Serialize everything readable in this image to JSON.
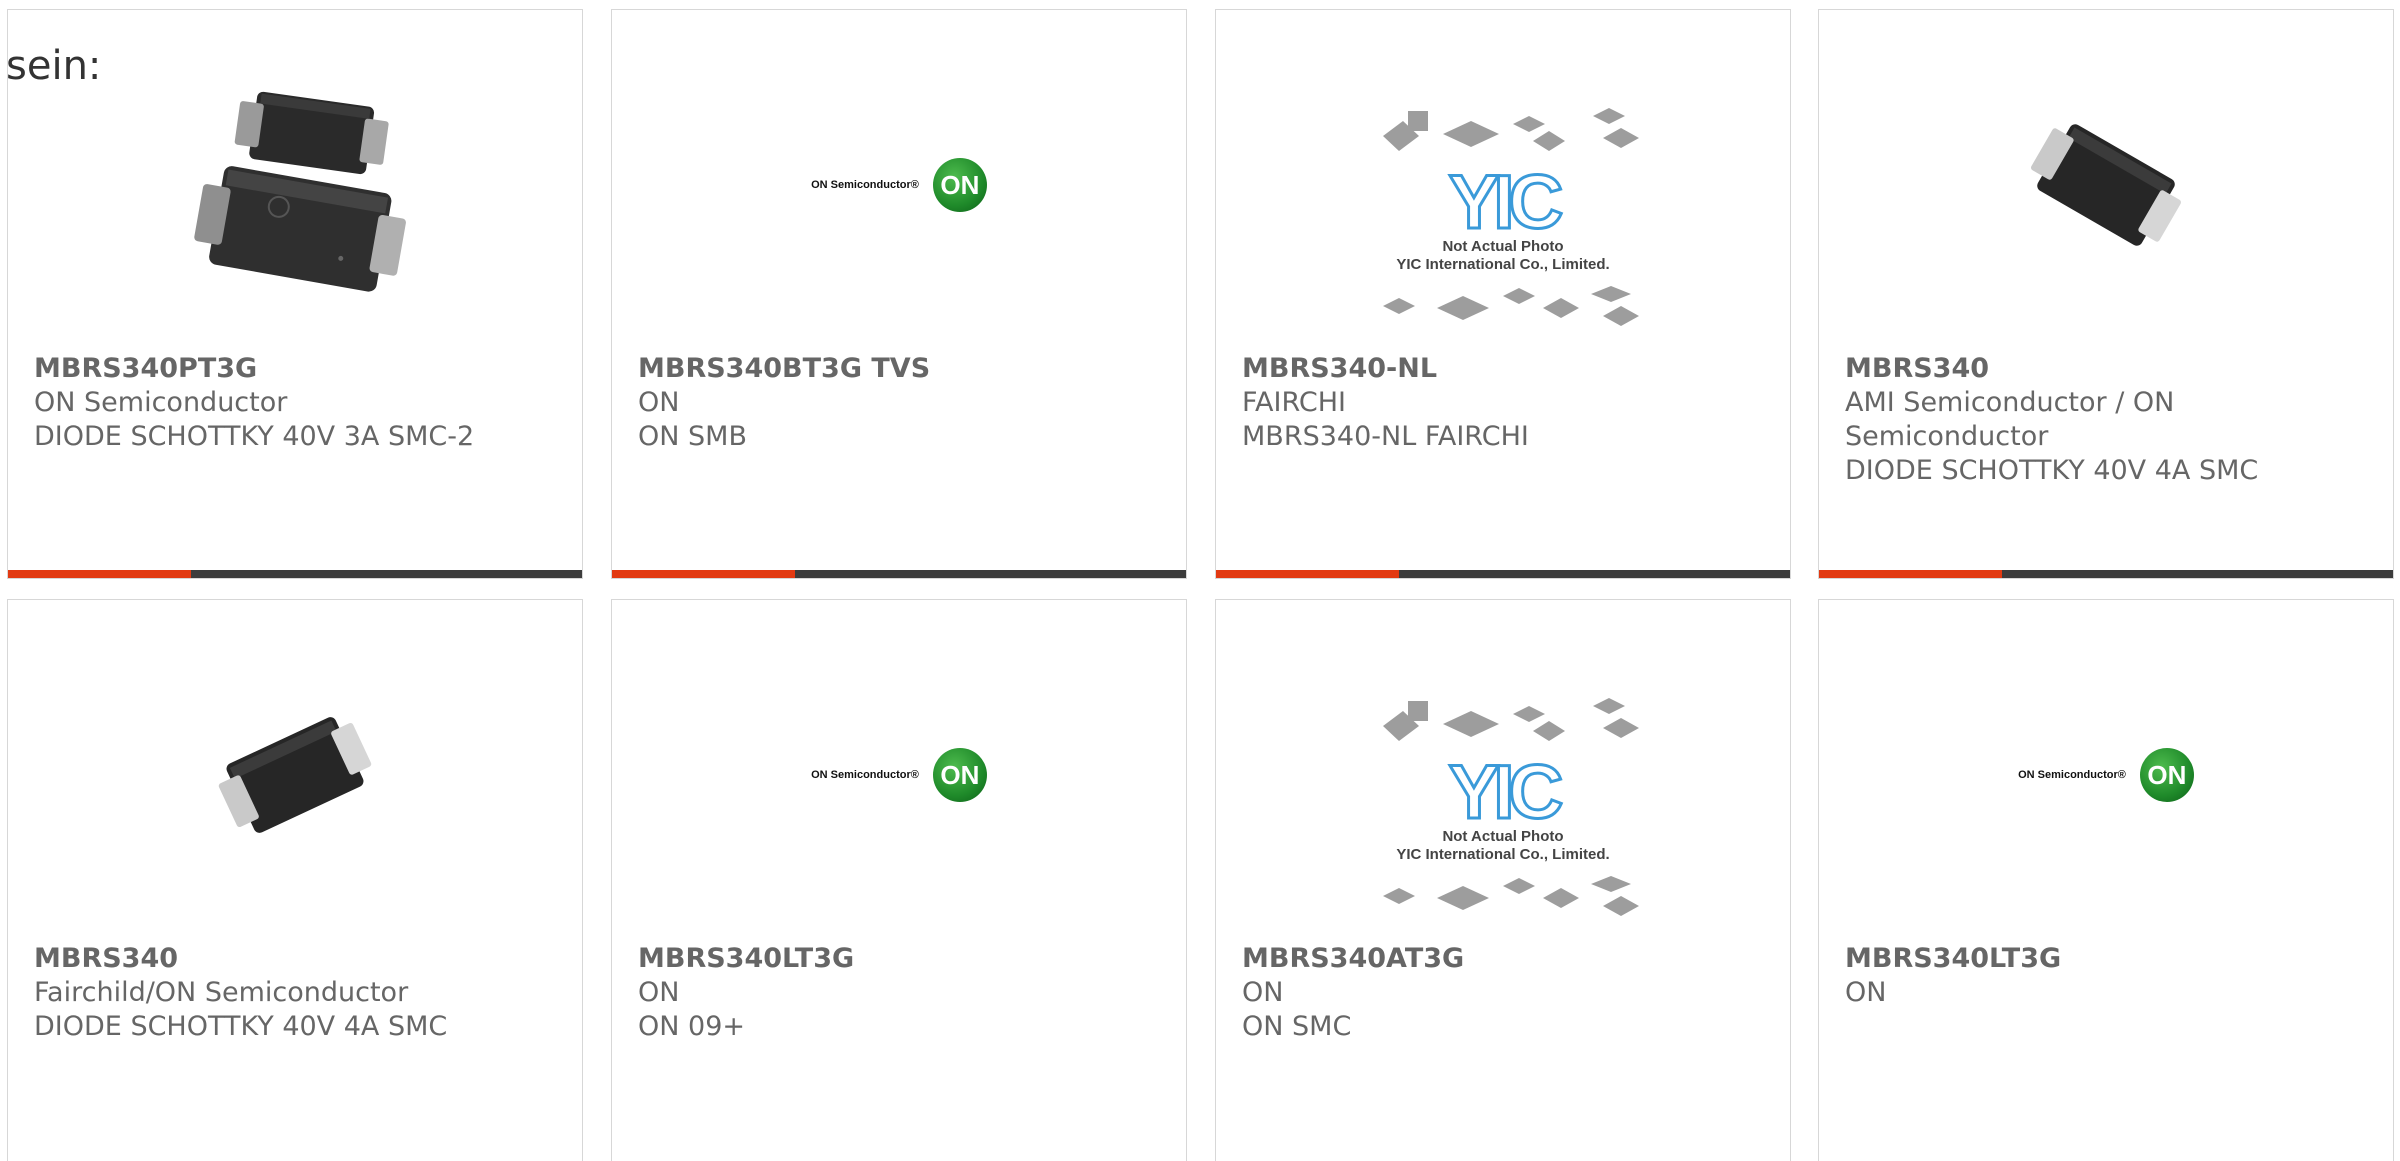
{
  "intro_text": "sein:",
  "colors": {
    "accent": "#e23a12",
    "bar_dark": "#3c3c3c",
    "border": "#d7d7d7",
    "text": "#666666"
  },
  "yic_placeholder": {
    "mark": "YIC",
    "line1": "Not Actual Photo",
    "line2": "YIC International Co., Limited."
  },
  "on_logo": {
    "text": "ON Semiconductor®",
    "circle": "ON"
  },
  "products": [
    {
      "part": "MBRS340PT3G",
      "maker": "ON Semiconductor",
      "desc": "DIODE SCHOTTKY 40V 3A SMC-2",
      "image": "smc-two-package-photo"
    },
    {
      "part": "MBRS340BT3G TVS",
      "maker": "ON",
      "desc": "ON SMB",
      "image": "on-semiconductor-logo"
    },
    {
      "part": "MBRS340-NL",
      "maker": "FAIRCHI",
      "desc": "MBRS340-NL FAIRCHI",
      "image": "yic-not-actual-photo"
    },
    {
      "part": "MBRS340",
      "maker": "AMI Semiconductor / ON Semiconductor",
      "desc": "DIODE SCHOTTKY 40V 4A SMC",
      "image": "smc-package-photo"
    },
    {
      "part": "MBRS340",
      "maker": "Fairchild/ON Semiconductor",
      "desc": "DIODE SCHOTTKY 40V 4A SMC",
      "image": "smc-package-photo"
    },
    {
      "part": "MBRS340LT3G",
      "maker": "ON",
      "desc": "ON 09+",
      "image": "on-semiconductor-logo"
    },
    {
      "part": "MBRS340AT3G",
      "maker": "ON",
      "desc": "ON SMC",
      "image": "yic-not-actual-photo"
    },
    {
      "part": "MBRS340LT3G",
      "maker": "ON",
      "desc": "",
      "image": "on-semiconductor-logo"
    }
  ]
}
